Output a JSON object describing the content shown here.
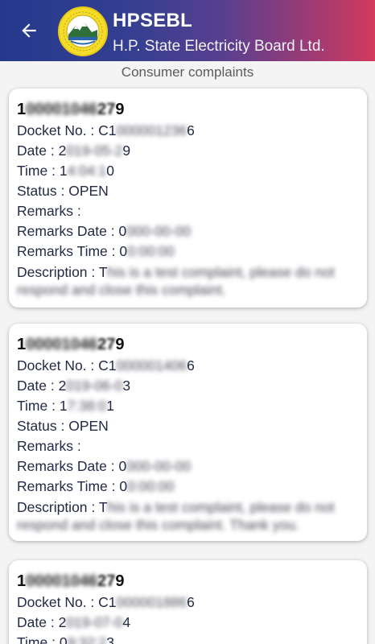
{
  "header": {
    "title": "HPSEBL",
    "subtitle": "H.P. State Electricity Board Ltd.",
    "back_icon": "arrow-left-icon",
    "logo_icon": "hpsebl-logo-icon",
    "gradient": [
      "#25398c",
      "#d33a5c"
    ]
  },
  "section_label": "Consumer complaints",
  "labels": {
    "docket": "Docket No. : ",
    "date": "Date : ",
    "time": "Time : ",
    "status": "Status : ",
    "remarks": "Remarks : ",
    "remarks_date": "Remarks Date : ",
    "remarks_time": "Remarks Time : ",
    "description": "Description : "
  },
  "complaints": [
    {
      "consumer_pre": "1",
      "consumer_blur": "00001046",
      "consumer_mid": "27",
      "consumer_post": "9",
      "docket_pre": "C1",
      "docket_blur": "000001236",
      "docket_post": "6",
      "date_pre": "2",
      "date_blur": "019-05-2",
      "date_post": "9",
      "time_pre": "1",
      "time_blur": "4:04:1",
      "time_post": "0",
      "status": "OPEN",
      "remarks": "",
      "remarks_date_pre": "0",
      "remarks_date_blur": "000-00-00",
      "remarks_time_pre": "0",
      "remarks_time_blur": "0:00:00",
      "description_pre": "T",
      "description_blur": "his is a test complaint, please do not respond and close this complaint."
    },
    {
      "consumer_pre": "1",
      "consumer_blur": "00001046",
      "consumer_mid": "27",
      "consumer_post": "9",
      "docket_pre": "C1",
      "docket_blur": "000001406",
      "docket_post": "6",
      "date_pre": "2",
      "date_blur": "019-06-0",
      "date_post": "3",
      "time_pre": "1",
      "time_blur": "7:38:0",
      "time_post": "1",
      "status": "OPEN",
      "remarks": "",
      "remarks_date_pre": "0",
      "remarks_date_blur": "000-00-00",
      "remarks_time_pre": "0",
      "remarks_time_blur": "0:00:00",
      "description_pre": "T",
      "description_blur": "his is a test complaint, please do not respond and close this complaint. Thank you."
    },
    {
      "consumer_pre": "1",
      "consumer_blur": "00001046",
      "consumer_mid": "27",
      "consumer_post": "9",
      "docket_pre": "C1",
      "docket_blur": "000001886",
      "docket_post": "6",
      "date_pre": "2",
      "date_blur": "019-07-0",
      "date_post": "4",
      "time_pre": "0",
      "time_blur": "9:32:2",
      "time_post": "3"
    }
  ]
}
